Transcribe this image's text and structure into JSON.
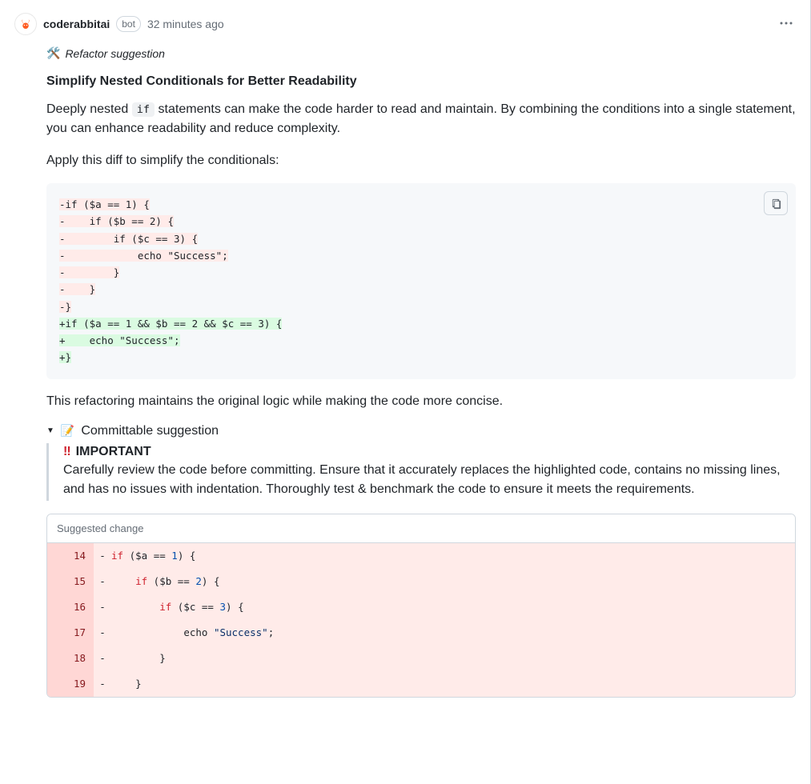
{
  "header": {
    "author": "coderabbitai",
    "bot_label": "bot",
    "timestamp": "32 minutes ago"
  },
  "suggestion": {
    "type_label": "Refactor suggestion",
    "title": "Simplify Nested Conditionals for Better Readability",
    "paragraph_1_pre": "Deeply nested ",
    "paragraph_1_code": "if",
    "paragraph_1_post": " statements can make the code harder to read and maintain. By combining the conditions into a single statement, you can enhance readability and reduce complexity.",
    "paragraph_2": "Apply this diff to simplify the conditionals:",
    "paragraph_3": "This refactoring maintains the original logic while making the code more concise."
  },
  "diff": {
    "lines": [
      {
        "text": "-if ($a == 1) {",
        "cls": "removed"
      },
      {
        "text": "-    if ($b == 2) {",
        "cls": "removed"
      },
      {
        "text": "-        if ($c == 3) {",
        "cls": "removed"
      },
      {
        "text": "-            echo \"Success\";",
        "cls": "removed"
      },
      {
        "text": "-        }",
        "cls": "removed"
      },
      {
        "text": "-    }",
        "cls": "removed"
      },
      {
        "text": "-}",
        "cls": "removed"
      },
      {
        "text": "+if ($a == 1 && $b == 2 && $c == 3) {",
        "cls": "added"
      },
      {
        "text": "+    echo \"Success\";",
        "cls": "added"
      },
      {
        "text": "+}",
        "cls": "added"
      }
    ]
  },
  "committable": {
    "summary_label": "Committable suggestion",
    "important_label": "IMPORTANT",
    "important_text": "Carefully review the code before committing. Ensure that it accurately replaces the highlighted code, contains no missing lines, and has no issues with indentation. Thoroughly test & benchmark the code to ensure it meets the requirements.",
    "header": "Suggested change",
    "rows": [
      {
        "lineno": "14",
        "marker": "-",
        "tokens": [
          [
            "if",
            "kw"
          ],
          [
            " ($a == ",
            "var"
          ],
          [
            "1",
            "num"
          ],
          [
            ") {",
            "var"
          ]
        ]
      },
      {
        "lineno": "15",
        "marker": "-",
        "tokens": [
          [
            "    if",
            "kw"
          ],
          [
            " ($b == ",
            "var"
          ],
          [
            "2",
            "num"
          ],
          [
            ") {",
            "var"
          ]
        ]
      },
      {
        "lineno": "16",
        "marker": "-",
        "tokens": [
          [
            "        if",
            "kw"
          ],
          [
            " ($c == ",
            "var"
          ],
          [
            "3",
            "num"
          ],
          [
            ") {",
            "var"
          ]
        ]
      },
      {
        "lineno": "17",
        "marker": "-",
        "tokens": [
          [
            "            ",
            "var"
          ],
          [
            "echo",
            "echo"
          ],
          [
            " ",
            "var"
          ],
          [
            "\"Success\"",
            "str"
          ],
          [
            ";",
            "var"
          ]
        ]
      },
      {
        "lineno": "18",
        "marker": "-",
        "tokens": [
          [
            "        }",
            "var"
          ]
        ]
      },
      {
        "lineno": "19",
        "marker": "-",
        "tokens": [
          [
            "    }",
            "var"
          ]
        ]
      }
    ]
  }
}
